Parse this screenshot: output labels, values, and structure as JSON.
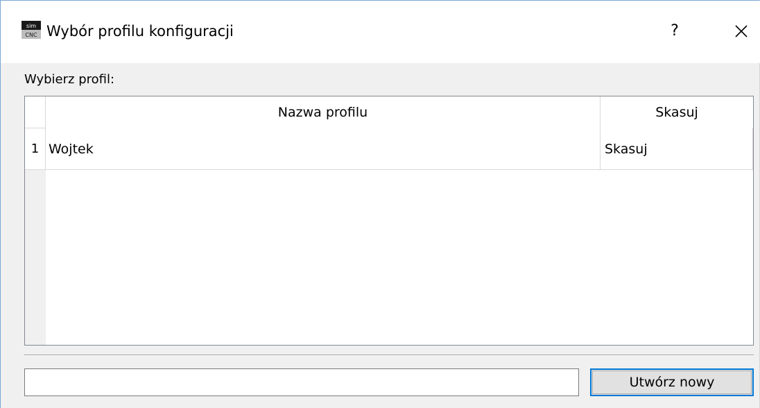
{
  "window": {
    "title": "Wybór profilu konfiguracji",
    "help_label": "?",
    "close_icon": "close-icon",
    "app_icon": "simcnc-app-icon",
    "app_icon_text_top": "sim",
    "app_icon_text_bottom": "CNC"
  },
  "dialog": {
    "prompt_label": "Wybierz profil:"
  },
  "profiles_table": {
    "columns": [
      "Nazwa profilu",
      "Skasuj"
    ],
    "rows": [
      {
        "number": "1",
        "name": "Wojtek",
        "delete_label": "Skasuj"
      }
    ]
  },
  "footer": {
    "new_profile_value": "",
    "new_profile_placeholder": "",
    "create_button_label": "Utwórz nowy"
  },
  "colors": {
    "accent": "#0078d7",
    "window_border": "#7aa7d6",
    "dialog_background": "#f0f0f0"
  }
}
